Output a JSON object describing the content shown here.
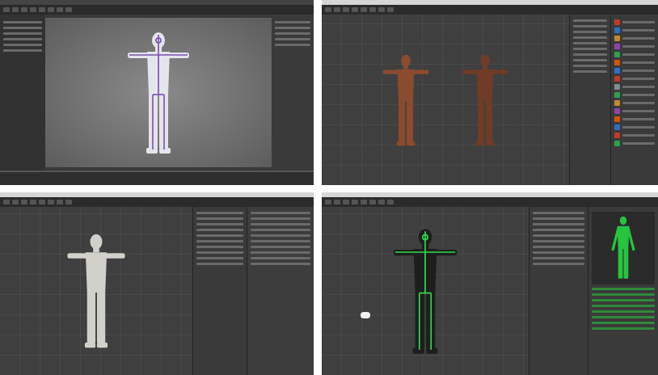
{
  "panels": [
    {
      "kind": "maya",
      "app": "Maya",
      "figures": [
        {
          "color": "#e4e4ec",
          "bones": true,
          "bone_color": "#7a4fae"
        }
      ],
      "side_panels": []
    },
    {
      "kind": "unity-pair",
      "app": "Unity",
      "figures": [
        {
          "color": "#8a4b2e",
          "bones": false,
          "bone_color": "#000000"
        },
        {
          "color": "#6e3c27",
          "bones": false,
          "bone_color": "#000000"
        }
      ],
      "side_panels": [
        {
          "kind": "hierarchy",
          "icon_colors": []
        },
        {
          "kind": "project",
          "icon_colors": [
            "#c0392b",
            "#2e6fc0",
            "#c08a2e",
            "#8e44ad",
            "#2e9e4f",
            "#d35400",
            "#2e6fc0",
            "#c0392b",
            "#7f8c8d",
            "#2e9e4f",
            "#c08a2e",
            "#8e44ad",
            "#d35400",
            "#2e6fc0",
            "#c0392b",
            "#2e9e4f"
          ]
        }
      ]
    },
    {
      "kind": "unity-single",
      "app": "Unity",
      "figures": [
        {
          "color": "#d2d0cb",
          "bones": false,
          "bone_color": "#000000"
        }
      ],
      "side_panels": [
        {
          "kind": "hierarchy",
          "icon_colors": []
        },
        {
          "kind": "inspector",
          "icon_colors": []
        }
      ]
    },
    {
      "kind": "unity-avatar",
      "app": "Unity",
      "figures": [
        {
          "color": "#1e1e1e",
          "bones": true,
          "bone_color": "#2fe04a"
        }
      ],
      "side_panels": [
        {
          "kind": "hierarchy",
          "icon_colors": []
        },
        {
          "kind": "avatar",
          "icon_colors": [],
          "avatar_color": "#27c43f"
        }
      ]
    }
  ]
}
